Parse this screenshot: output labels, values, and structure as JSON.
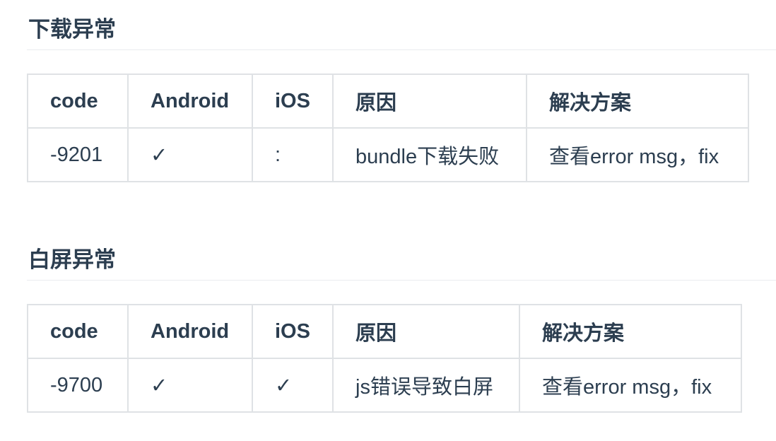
{
  "sections": [
    {
      "title": "下载异常",
      "columns": [
        "code",
        "Android",
        "iOS",
        "原因",
        "解决方案"
      ],
      "rows": [
        {
          "code": "-9201",
          "android": "✓",
          "ios": ":",
          "reason": "bundle下载失败",
          "solution": "查看error msg，fix"
        }
      ]
    },
    {
      "title": "白屏异常",
      "columns": [
        "code",
        "Android",
        "iOS",
        "原因",
        "解决方案"
      ],
      "rows": [
        {
          "code": "-9700",
          "android": "✓",
          "ios": "✓",
          "reason": "js错误导致白屏",
          "solution": "查看error msg，fix"
        }
      ]
    }
  ],
  "colors": {
    "text": "#2c3e50",
    "border": "#dfe2e5",
    "rule": "#eaecef"
  }
}
